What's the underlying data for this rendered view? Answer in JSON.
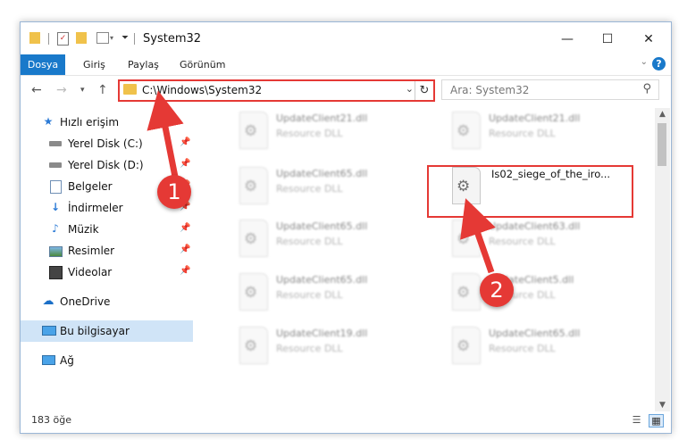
{
  "window": {
    "title": "System32",
    "controls": {
      "minimize": "—",
      "maximize": "☐",
      "close": "✕"
    }
  },
  "ribbon": {
    "tabs": [
      "Dosya",
      "Giriş",
      "Paylaş",
      "Görünüm"
    ],
    "help": "?"
  },
  "nav": {
    "address_path": "C:\\Windows\\System32",
    "search_placeholder": "Ara: System32"
  },
  "sidebar": {
    "quick_access": "Hızlı erişim",
    "items": [
      {
        "label": "Yerel Disk (C:)",
        "icon": "drive-icon",
        "pinned": true
      },
      {
        "label": "Yerel Disk (D:)",
        "icon": "drive-icon",
        "pinned": true
      },
      {
        "label": "Belgeler",
        "icon": "documents-icon",
        "pinned": true
      },
      {
        "label": "İndirmeler",
        "icon": "downloads-icon",
        "pinned": true
      },
      {
        "label": "Müzik",
        "icon": "music-icon",
        "pinned": true
      },
      {
        "label": "Resimler",
        "icon": "pictures-icon",
        "pinned": true
      },
      {
        "label": "Videolar",
        "icon": "videos-icon",
        "pinned": true
      }
    ],
    "onedrive": "OneDrive",
    "this_pc": "Bu bilgisayar",
    "network": "Ağ"
  },
  "files": {
    "left_column": [
      {
        "name": "UpdateClient21.dll",
        "type": "Resource DLL"
      },
      {
        "name": "UpdateClient65.dll",
        "type": "Resource DLL"
      },
      {
        "name": "UpdateClient65.dll",
        "type": "Resource DLL"
      },
      {
        "name": "UpdateClient65.dll",
        "type": "Resource DLL"
      },
      {
        "name": "UpdateClient19.dll",
        "type": "Resource DLL"
      }
    ],
    "right_column": [
      {
        "name": "UpdateClient21.dll",
        "type": "Resource DLL"
      },
      {
        "name": "UpdateClient63.dll",
        "type": "Resource DLL"
      },
      {
        "name": "UpdateClient5.dll",
        "type": "Resource DLL"
      },
      {
        "name": "UpdateClient65.dll",
        "type": "Resource DLL"
      }
    ],
    "selected": {
      "name": "Is02_siege_of_the_iro..."
    }
  },
  "status": {
    "item_count": "183 öğe"
  },
  "callouts": [
    "1",
    "2"
  ],
  "colors": {
    "accent": "#1979ca",
    "highlight": "#e53935",
    "folder": "#f0c24b",
    "selection": "#d0e4f7"
  }
}
